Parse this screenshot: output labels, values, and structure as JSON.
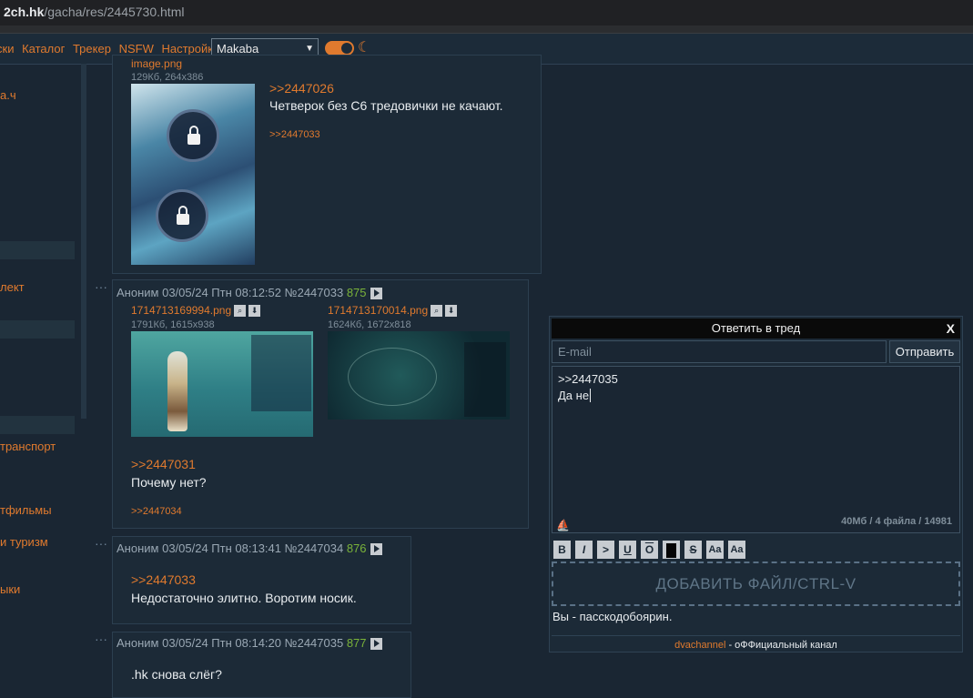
{
  "browser": {
    "host": "2ch.hk",
    "path": "/gacha/res/2445730.html"
  },
  "nav": {
    "links": [
      "ски",
      "Каталог",
      "Трекер",
      "NSFW",
      "Настройки"
    ],
    "style_select": "Makaba",
    "moon_icon": "☾"
  },
  "sidebar": {
    "items": [
      "a.ч",
      "лект",
      "транспорт",
      "тфильмы",
      "и туризм",
      "ыки"
    ]
  },
  "posts": [
    {
      "files": [
        {
          "name": "image.png",
          "meta": "129Кб, 264x386"
        }
      ],
      "reply": ">>2447026",
      "text": "Четверок без С6 тредовички не качают.",
      "backref": ">>2447033"
    },
    {
      "author": "Аноним",
      "date": "03/05/24 Птн 08:12:52",
      "num": "№2447033",
      "count": "875",
      "files": [
        {
          "name": "1714713169994.png",
          "meta": "1791Кб, 1615x938"
        },
        {
          "name": "1714713170014.png",
          "meta": "1624Кб, 1672x818"
        }
      ],
      "reply": ">>2447031",
      "text": "Почему нет?",
      "backref": ">>2447034"
    },
    {
      "author": "Аноним",
      "date": "03/05/24 Птн 08:13:41",
      "num": "№2447034",
      "count": "876",
      "reply": ">>2447033",
      "text": "Недостаточно элитно. Воротим носик."
    },
    {
      "author": "Аноним",
      "date": "03/05/24 Птн 08:14:20",
      "num": "№2447035",
      "count": "877",
      "text": ".hk снова слёг?"
    }
  ],
  "reply_form": {
    "title": "Ответить в тред",
    "close": "X",
    "email_placeholder": "E-mail",
    "send_label": "Отправить",
    "message_line1": ">>2447035",
    "message_line2": "Да не",
    "limits": "40Мб / 4 файла / 14981",
    "format_buttons": [
      "B",
      "I",
      ">",
      "U",
      "O",
      "",
      "S",
      "Aa",
      "Aa"
    ],
    "dropzone": "ДОБАВИТЬ ФАЙЛ/CTRL-V",
    "status": "Вы - пасскодобоярин.",
    "footer_link": "dvachannel",
    "footer_text": " - оФФициальный канал"
  },
  "colors": {
    "accent": "#e07a2e",
    "background": "#1a2633",
    "post_bg": "#1c2a37",
    "count_green": "#7ab33a"
  }
}
